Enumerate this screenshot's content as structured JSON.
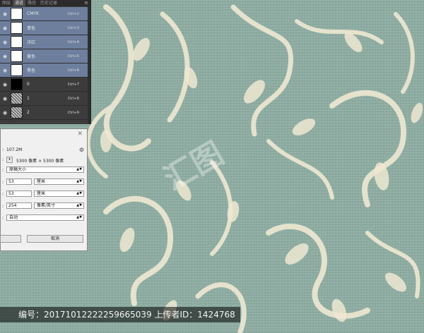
{
  "channels_panel": {
    "tabs": [
      "图层",
      "通道",
      "路径",
      "历史记录"
    ],
    "active_tab": 1,
    "menu_icon": "panel-menu-icon",
    "rows": [
      {
        "name": "CMYK",
        "shortcut": "Ctrl+2",
        "selected": true,
        "thumb": "white"
      },
      {
        "name": "青色",
        "shortcut": "Ctrl+3",
        "selected": true,
        "thumb": "white"
      },
      {
        "name": "洋红",
        "shortcut": "Ctrl+4",
        "selected": true,
        "thumb": "white"
      },
      {
        "name": "黄色",
        "shortcut": "Ctrl+5",
        "selected": true,
        "thumb": "white"
      },
      {
        "name": "黑色",
        "shortcut": "Ctrl+6",
        "selected": true,
        "thumb": "white"
      },
      {
        "name": "0",
        "shortcut": "Ctrl+7",
        "selected": false,
        "thumb": "black"
      },
      {
        "name": "1",
        "shortcut": "Ctrl+8",
        "selected": false,
        "thumb": "noise"
      },
      {
        "name": "2",
        "shortcut": "Ctrl+9",
        "selected": false,
        "thumb": "noise"
      }
    ]
  },
  "image_size_dialog": {
    "close_icon": "close-icon",
    "size_value": "107.2M",
    "dimensions_label": "5300 像素 × 5300 像素",
    "fit_to_value": "原稿大小",
    "width_value": "53",
    "width_unit": "厘米",
    "height_value": "53",
    "height_unit": "厘米",
    "resolution_value": "254",
    "resolution_unit": "像素/英寸",
    "resample_value": "自动",
    "cancel_label": "取消",
    "gear_icon": "gear-icon"
  },
  "watermark": {
    "text": "编号：20171012222259665039 上传者ID：1424768"
  },
  "colors": {
    "canvas": "#8eaca2",
    "pattern": "#efe8d2",
    "selected_row": "#6d7f9d"
  }
}
